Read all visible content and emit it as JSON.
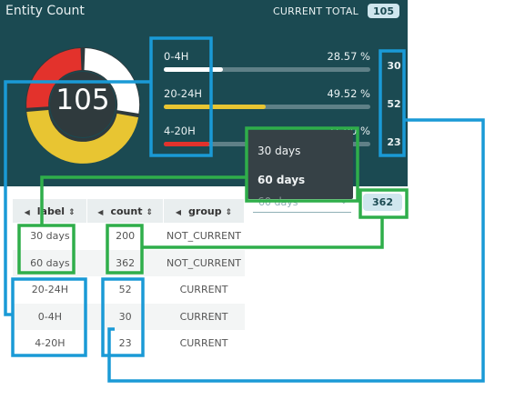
{
  "header": {
    "title": "Entity Count",
    "total_label": "CURRENT TOTAL",
    "total_value": "105"
  },
  "gauge": {
    "value": "105"
  },
  "metrics": [
    {
      "label": "0-4H",
      "percent": "28.57 %",
      "fraction": 0.2857,
      "count": "30",
      "color": "#ffffff"
    },
    {
      "label": "20-24H",
      "percent": "49.52 %",
      "fraction": 0.4952,
      "count": "52",
      "color": "#e8c532"
    },
    {
      "label": "4-20H",
      "percent": "21.90 %",
      "fraction": 0.219,
      "count": "23",
      "color": "#e3322c"
    }
  ],
  "dropdown": {
    "options": [
      "30 days",
      "60 days"
    ],
    "selected": "60 days",
    "badge": "362"
  },
  "table": {
    "columns": [
      "label",
      "count",
      "group"
    ],
    "rows": [
      {
        "label": "30 days",
        "count": "200",
        "group": "NOT_CURRENT"
      },
      {
        "label": "60 days",
        "count": "362",
        "group": "NOT_CURRENT"
      },
      {
        "label": "20-24H",
        "count": "52",
        "group": "CURRENT"
      },
      {
        "label": "0-4H",
        "count": "30",
        "group": "CURRENT"
      },
      {
        "label": "4-20H",
        "count": "23",
        "group": "CURRENT"
      }
    ]
  },
  "colors": {
    "panel": "#1b4a52",
    "annotation_blue": "#1a9ad6",
    "annotation_green": "#2fae4a"
  }
}
